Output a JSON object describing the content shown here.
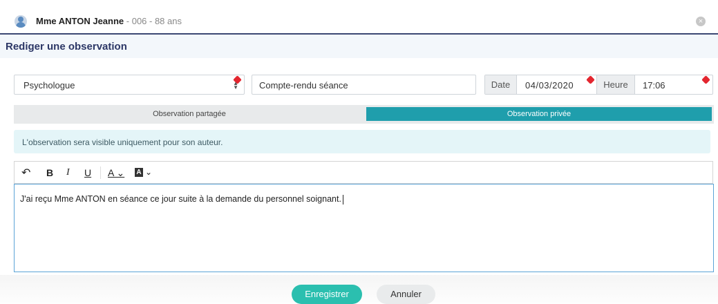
{
  "header": {
    "patient_name": "Mme ANTON Jeanne",
    "patient_meta": " - 006 - 88 ans",
    "close_symbol": "×"
  },
  "dialog": {
    "title": "Rediger une observation"
  },
  "form": {
    "profession": "Psychologue",
    "observation_type": "Compte-rendu séance",
    "date_label": "Date",
    "date_value": "04/03/2020",
    "time_label": "Heure",
    "time_value": "17:06"
  },
  "tabs": {
    "shared": "Observation partagée",
    "private": "Observation privée",
    "active": "private"
  },
  "info": {
    "message": "L'observation sera visible uniquement pour son auteur."
  },
  "toolbar": {
    "undo": "↶",
    "bold": "B",
    "italic": "I",
    "underline": "U",
    "font_color": "A ⌄",
    "highlight": "⌄"
  },
  "editor": {
    "content": "J'ai reçu Mme ANTON en séance ce jour suite à la demande du personnel soignant."
  },
  "actions": {
    "save": "Enregistrer",
    "cancel": "Annuler"
  },
  "colors": {
    "accent": "#1f9eac",
    "save_button": "#2bbfaf",
    "title": "#2c3766",
    "required_flag": "#e3262f"
  }
}
